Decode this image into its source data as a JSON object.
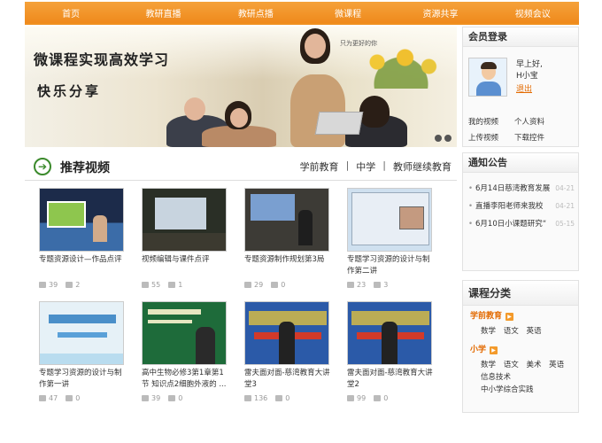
{
  "nav": [
    "首页",
    "教研直播",
    "教研点播",
    "微课程",
    "资源共享",
    "视频会议"
  ],
  "banner": {
    "title": "微课程实现高效学习",
    "subtitle": "快乐分享",
    "tagline": "只为更好的你"
  },
  "videos_section": {
    "title": "推荐视频",
    "links": [
      "学前教育",
      "中学",
      "教师继续教育"
    ],
    "separator": "|"
  },
  "videos": [
    {
      "title": "专题资源设计—作品点评",
      "views": "39",
      "comments": "2",
      "thumb": "classroom"
    },
    {
      "title": "视频编辑与课件点评",
      "views": "55",
      "comments": "1",
      "thumb": "projector"
    },
    {
      "title": "专题资源制作规划第3局",
      "views": "29",
      "comments": "0",
      "thumb": "lecture"
    },
    {
      "title": "专题学习资源的设计与制作第二讲",
      "views": "23",
      "comments": "3",
      "thumb": "screen"
    },
    {
      "title": "专题学习资源的设计与制作第一讲",
      "views": "47",
      "comments": "0",
      "thumb": "slide"
    },
    {
      "title": "高中生物必修3第1章第1节 知识点2细胞外液的 ...",
      "views": "39",
      "comments": "0",
      "thumb": "green"
    },
    {
      "title": "雷夫面对面-慈湾教育大讲堂3",
      "views": "136",
      "comments": "0",
      "thumb": "stage"
    },
    {
      "title": "雷夫面对面-慈湾教育大讲堂2",
      "views": "99",
      "comments": "0",
      "thumb": "stage"
    }
  ],
  "member": {
    "title": "会员登录",
    "greeting": "早上好,",
    "username": "H小宝",
    "logout": "退出",
    "links": [
      "我的视频",
      "个人资料",
      "上传视频",
      "下载控件"
    ]
  },
  "notices": {
    "title": "通知公告",
    "items": [
      {
        "text": "6月14日慈湾教育发展",
        "date": "04-21"
      },
      {
        "text": "直播李阳老师来我校",
        "date": "04-21"
      },
      {
        "text": "6月10日小课题研究“",
        "date": "05-15"
      }
    ]
  },
  "categories": {
    "title": "课程分类",
    "groups": [
      {
        "name": "学前教育",
        "items": [
          "数学",
          "语文",
          "英语"
        ]
      },
      {
        "name": "小学",
        "items": [
          "数学",
          "语文",
          "美术",
          "英语",
          "信息技术",
          "中小学综合实践"
        ]
      }
    ]
  },
  "colors": {
    "accent": "#ef8a1c",
    "link_orange": "#e36a00",
    "green": "#3b8a2c"
  }
}
